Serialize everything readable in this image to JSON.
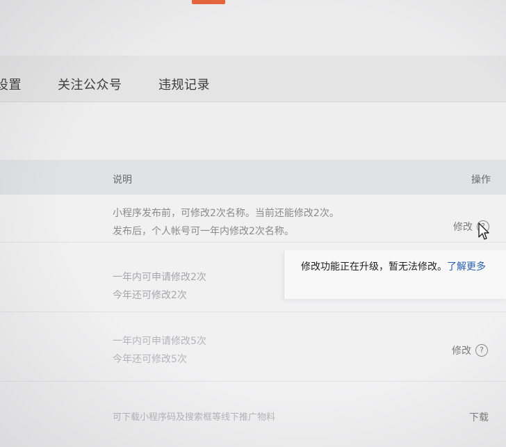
{
  "nav": {
    "tabs": [
      "设置",
      "关注公众号",
      "违规记录"
    ]
  },
  "table": {
    "headers": {
      "desc": "说明",
      "action": "操作"
    },
    "rows": [
      {
        "lines": [
          "小程序发布前，可修改2次名称。当前还能修改2次。",
          "发布后，个人帐号可一年内修改2次名称。"
        ],
        "action": "修改"
      },
      {
        "lines": [
          "一年内可申请修改2次",
          "今年还可修改2次"
        ],
        "action": ""
      },
      {
        "lines": [
          "一年内可申请修改5次",
          "今年还可修改5次"
        ],
        "action": "修改"
      },
      {
        "lines": [
          "可下载小程序码及搜索框等线下推广物料"
        ],
        "action": "下载"
      }
    ]
  },
  "tooltip": {
    "text": "修改功能正在升级，暂无法修改。",
    "link": "了解更多"
  },
  "icons": {
    "help": "?"
  },
  "colors": {
    "accent_orange": "#e8633a",
    "link_blue": "#2a5fb0",
    "header_bg": "#e0e2e6"
  }
}
